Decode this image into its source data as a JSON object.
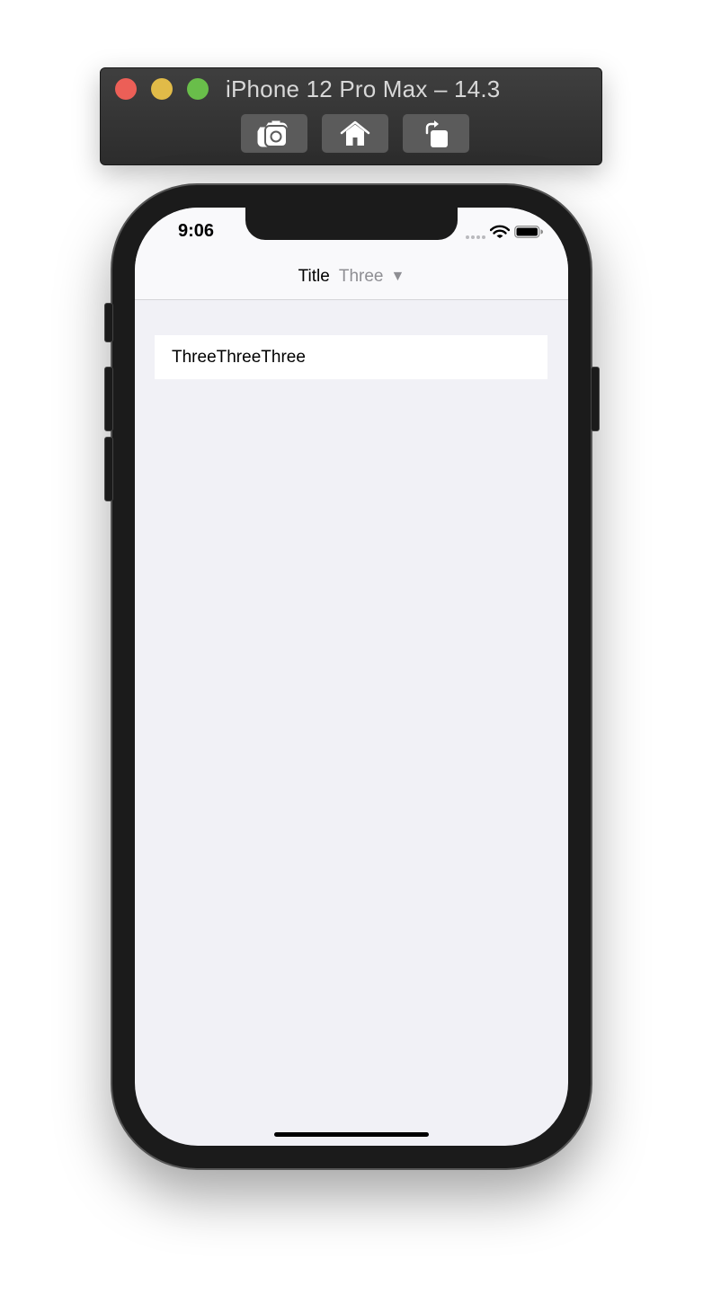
{
  "simulator": {
    "window_title": "iPhone 12 Pro Max – 14.3",
    "toolbar": [
      {
        "icon": "camera-icon",
        "action": "screenshot"
      },
      {
        "icon": "home-icon",
        "action": "home"
      },
      {
        "icon": "rotate-icon",
        "action": "rotate"
      }
    ]
  },
  "status_bar": {
    "time": "9:06",
    "icons": [
      "signal-icon",
      "wifi-icon",
      "battery-icon"
    ]
  },
  "nav": {
    "title": "Title",
    "subtitle": "Three",
    "arrow": "▼"
  },
  "list": {
    "items": [
      "ThreeThreeThree"
    ]
  },
  "colors": {
    "background": "#f1f1f6",
    "navbar": "#f9f9fb",
    "subtitle": "#8e8e93"
  }
}
